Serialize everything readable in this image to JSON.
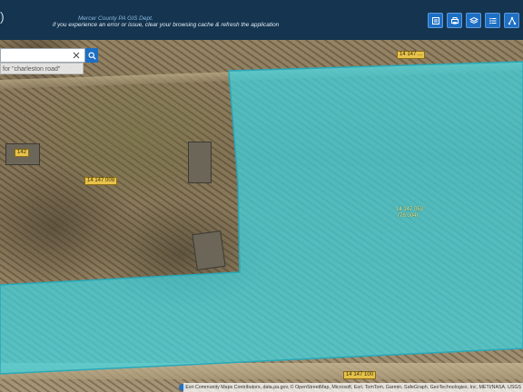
{
  "header": {
    "department": "Mercer County PA GIS Dept.",
    "notice": "if you experience an error or issue, clear your browsing cache & refresh the application",
    "logo_glyph": ")"
  },
  "tools": [
    {
      "name": "legend-tool-button",
      "icon": "legend-icon"
    },
    {
      "name": "print-tool-button",
      "icon": "print-icon"
    },
    {
      "name": "layers-tool-button",
      "icon": "layers-icon"
    },
    {
      "name": "list-tool-button",
      "icon": "list-icon"
    },
    {
      "name": "share-tool-button",
      "icon": "share-icon"
    }
  ],
  "search": {
    "value": "",
    "hint": "for \"charleston road\""
  },
  "parcels": {
    "top_right": "14 147 ...",
    "house": "142",
    "left": "14 147 009",
    "center": "14 147 053",
    "center_sub": "(76.004)",
    "bottom": "14 147 100"
  },
  "attribution": "Esri Community Maps Contributors, data.pa.gov, © OpenStreetMap, Microsoft, Esri, TomTom, Garmin, SafeGraph, GeoTechnologies, Inc, METI/NASA, USGS",
  "colors": {
    "header_bg": "#14344f",
    "tool_bg": "#1e6fc4",
    "parcel_highlight": "#3fd4e2"
  }
}
